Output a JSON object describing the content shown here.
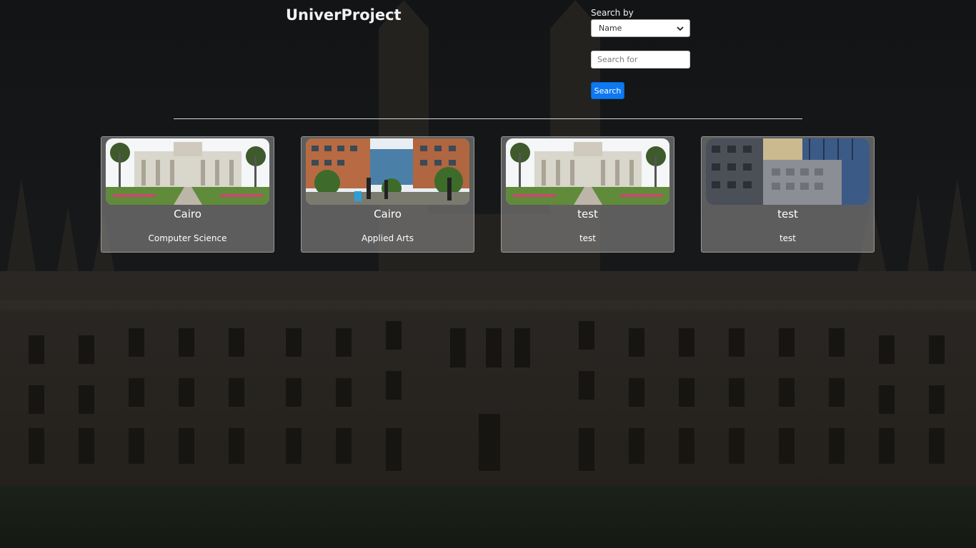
{
  "app": {
    "title": "UniverProject"
  },
  "search": {
    "label": "Search by",
    "selected_option": "Name",
    "input_placeholder": "Search for",
    "input_value": "",
    "button_label": "Search"
  },
  "cards": [
    {
      "name": "Cairo",
      "department": "Computer Science",
      "image": "palace-campus-photo"
    },
    {
      "name": "Cairo",
      "department": "Applied Arts",
      "image": "modern-campus-courtyard-photo"
    },
    {
      "name": "test",
      "department": "test",
      "image": "palace-campus-photo"
    },
    {
      "name": "test",
      "department": "test",
      "image": "city-buildings-photo"
    }
  ],
  "colors": {
    "accent": "#0d78f2",
    "card_bg": "#787878",
    "page_bg": "#1d1b19"
  }
}
